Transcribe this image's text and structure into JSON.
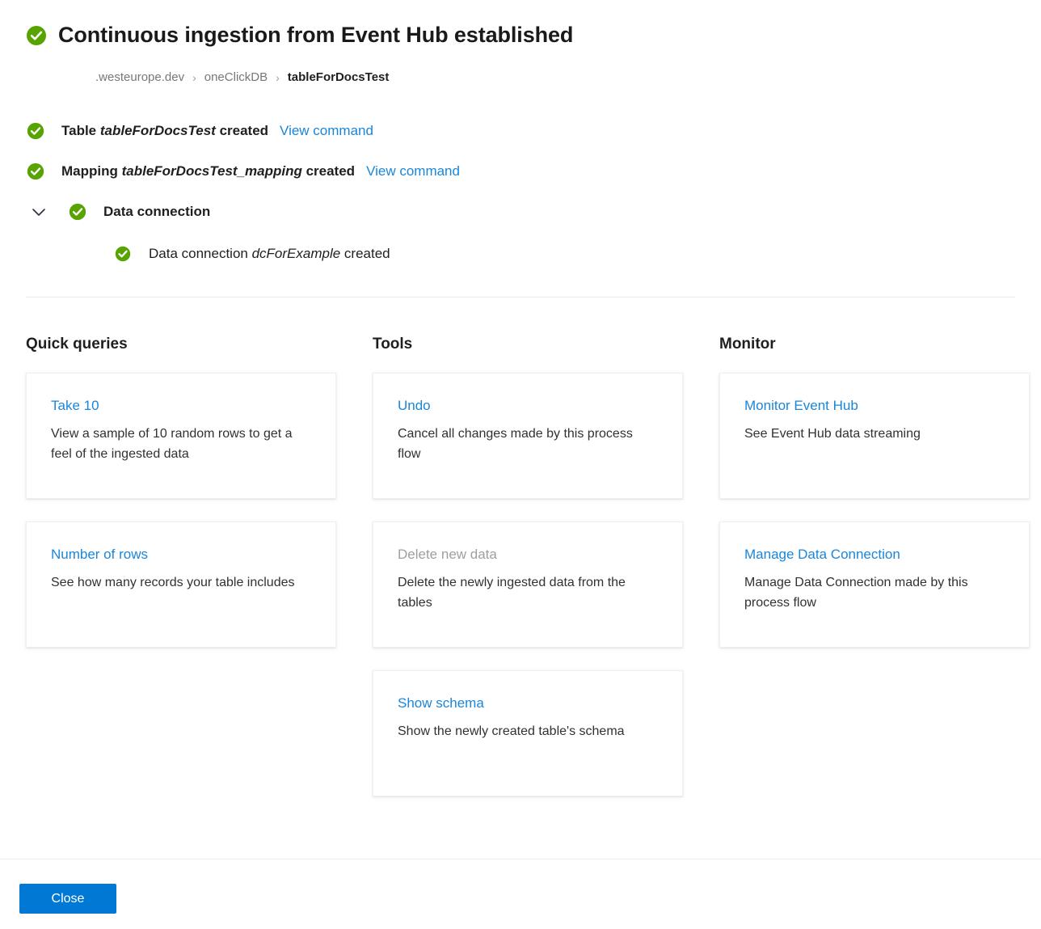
{
  "header": {
    "status_icon": "success-check-icon",
    "title": "Continuous ingestion from Event Hub established",
    "breadcrumb": {
      "separator": "›",
      "items": [
        {
          "label": ".westeurope.dev",
          "current": false
        },
        {
          "label": "oneClickDB",
          "current": false
        },
        {
          "label": "tableForDocsTest",
          "current": true
        }
      ]
    }
  },
  "status_list": [
    {
      "icon": "success-check-icon",
      "prefix": "Table ",
      "emphasis": "tableForDocsTest",
      "suffix": " created",
      "link": "View command"
    },
    {
      "icon": "success-check-icon",
      "prefix": "Mapping ",
      "emphasis": "tableForDocsTest_mapping",
      "suffix": " created",
      "link": "View command"
    },
    {
      "icon": "success-check-icon",
      "chevron": "chevron-down-icon",
      "label": "Data connection"
    },
    {
      "icon": "success-check-icon",
      "prefix": "Data connection ",
      "emphasis": "dcForExample",
      "suffix": " created"
    }
  ],
  "columns": [
    {
      "title": "Quick queries",
      "cards": [
        {
          "link": "Take 10",
          "disabled": false,
          "description": "View a sample of 10 random rows to get a feel of the ingested data"
        },
        {
          "link": "Number of rows",
          "disabled": false,
          "description": "See how many records your table includes"
        }
      ]
    },
    {
      "title": "Tools",
      "cards": [
        {
          "link": "Undo",
          "disabled": false,
          "description": "Cancel all changes made by this process flow"
        },
        {
          "link": "Delete new data",
          "disabled": true,
          "description": "Delete the newly ingested data from the tables"
        },
        {
          "link": "Show schema",
          "disabled": false,
          "description": "Show the newly created table's schema"
        }
      ]
    },
    {
      "title": "Monitor",
      "cards": [
        {
          "link": "Monitor Event Hub",
          "disabled": false,
          "description": "See Event Hub data streaming"
        },
        {
          "link": "Manage Data Connection",
          "disabled": false,
          "description": "Manage Data Connection made by this process flow"
        }
      ]
    }
  ],
  "footer": {
    "close_label": "Close"
  },
  "colors": {
    "success_green": "#57a300",
    "link_blue": "#1a86d9",
    "primary_button": "#0078d4",
    "disabled_text": "#a19f9d",
    "text_primary": "#201f1e",
    "divider": "#edebe9"
  }
}
